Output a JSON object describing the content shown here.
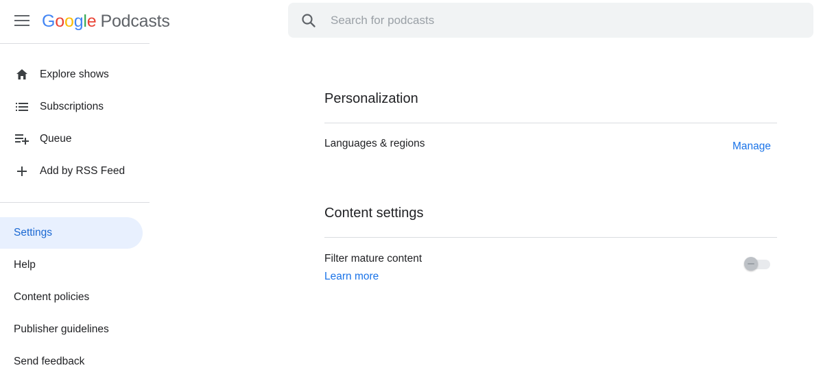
{
  "header": {
    "logo_letters": [
      "G",
      "o",
      "o",
      "g",
      "l",
      "e"
    ],
    "product_name": "Podcasts",
    "search_placeholder": "Search for podcasts",
    "search_value": ""
  },
  "sidebar": {
    "nav": [
      {
        "label": "Explore shows",
        "icon": "home-icon"
      },
      {
        "label": "Subscriptions",
        "icon": "list-icon"
      },
      {
        "label": "Queue",
        "icon": "playlist-add-icon"
      },
      {
        "label": "Add by RSS Feed",
        "icon": "plus-icon"
      }
    ],
    "secondary": [
      {
        "label": "Settings",
        "active": true
      },
      {
        "label": "Help",
        "active": false
      },
      {
        "label": "Content policies",
        "active": false
      },
      {
        "label": "Publisher guidelines",
        "active": false
      },
      {
        "label": "Send feedback",
        "active": false
      }
    ]
  },
  "main": {
    "personalization": {
      "title": "Personalization",
      "languages_label": "Languages & regions",
      "manage_link": "Manage"
    },
    "content_settings": {
      "title": "Content settings",
      "filter_label": "Filter mature content",
      "learn_more_link": "Learn more",
      "filter_enabled": false
    }
  },
  "colors": {
    "accent": "#1a73e8",
    "active_bg": "#e8f0fe",
    "divider": "#dadce0",
    "search_bg": "#f1f3f4"
  }
}
